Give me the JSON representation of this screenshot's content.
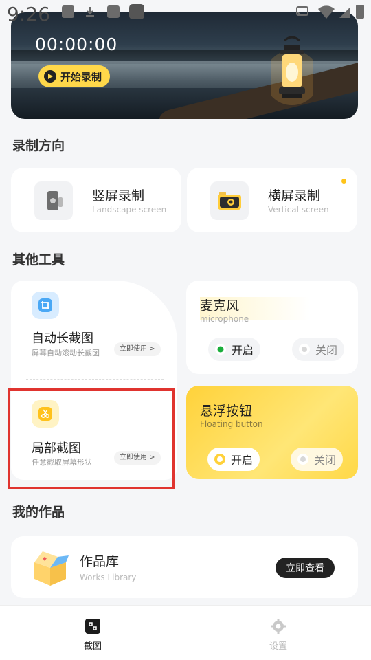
{
  "status_bar": {
    "time": "9:26"
  },
  "hero": {
    "timer": "00:00:00",
    "record_label": "开始录制"
  },
  "sections": {
    "direction": "录制方向",
    "tools": "其他工具",
    "works": "我的作品"
  },
  "direction_cards": [
    {
      "title": "竖屏录制",
      "subtitle": "Landscape screen"
    },
    {
      "title": "横屏录制",
      "subtitle": "Vertical screen"
    }
  ],
  "tools": {
    "auto_long": {
      "title": "自动长截图",
      "desc": "屏幕自动滚动长截图",
      "action": "立即使用 >"
    },
    "partial": {
      "title": "局部截图",
      "desc": "任意截取屏幕形状",
      "action": "立即使用 >"
    },
    "microphone": {
      "title": "麦克风",
      "subtitle": "microphone",
      "on": "开启",
      "off": "关闭",
      "selected": "on"
    },
    "floating": {
      "title": "悬浮按钮",
      "subtitle": "Floating button",
      "on": "开启",
      "off": "关闭",
      "selected": "on"
    }
  },
  "works_card": {
    "title": "作品库",
    "subtitle": "Works Library",
    "view_label": "立即查看"
  },
  "bottom_nav": [
    {
      "label": "截图",
      "icon": "screenshot-icon",
      "active": true
    },
    {
      "label": "设置",
      "icon": "gear-icon",
      "active": false
    }
  ],
  "colors": {
    "accent": "#ffd84a",
    "highlight": "#e0342f",
    "on_dot": "#1aae3b"
  }
}
